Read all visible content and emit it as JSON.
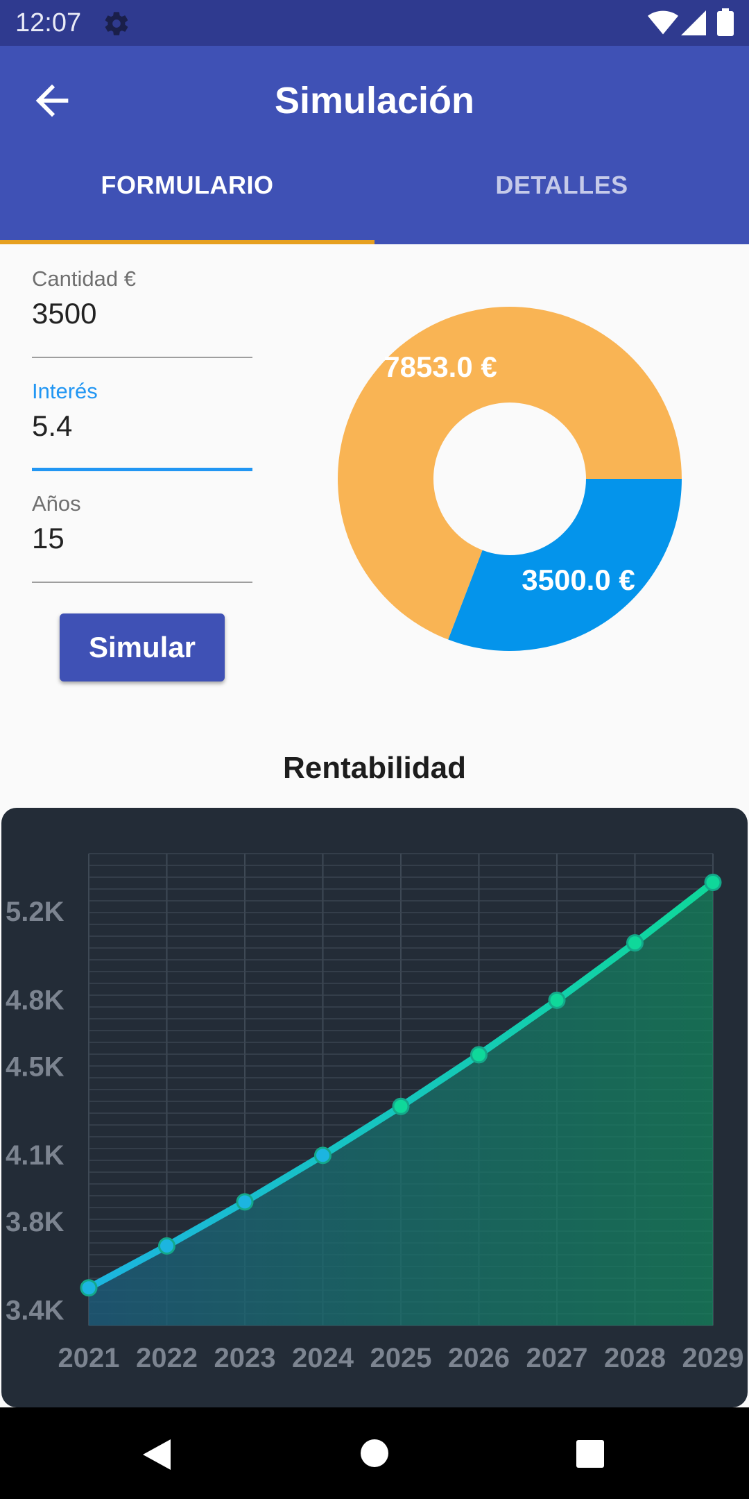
{
  "status_bar": {
    "time": "12:07"
  },
  "app_bar": {
    "title": "Simulación"
  },
  "tabs": [
    {
      "label": "FORMULARIO",
      "selected": true
    },
    {
      "label": "DETALLES",
      "selected": false
    }
  ],
  "form": {
    "cantidad": {
      "label": "Cantidad €",
      "value": "3500"
    },
    "interes": {
      "label": "Interés",
      "value": "5.4"
    },
    "anos": {
      "label": "Años",
      "value": "15"
    },
    "submit_label": "Simular"
  },
  "pie": {
    "slices": [
      {
        "label": "7853.0 €",
        "value": 7853.0,
        "color": "#f9b454"
      },
      {
        "label": "3500.0 €",
        "value": 3500.0,
        "color": "#0494eb"
      }
    ]
  },
  "section": {
    "title": "Rentabilidad"
  },
  "chart_data": {
    "type": "line",
    "x": [
      "2021",
      "2022",
      "2023",
      "2024",
      "2025",
      "2026",
      "2027",
      "2028",
      "2029"
    ],
    "series": [
      {
        "values": [
          3500,
          3689,
          3888,
          4098,
          4319,
          4552,
          4798,
          5057,
          5330
        ]
      }
    ],
    "y_tick_labels": [
      "3.4K",
      "3.8K",
      "4.1K",
      "4.5K",
      "4.8K",
      "5.2K"
    ],
    "y_tick_values": [
      3400,
      3800,
      4100,
      4500,
      4800,
      5200
    ],
    "ylim": [
      3330,
      5460
    ],
    "grid": true
  },
  "colors": {
    "primary": "#3f51b5",
    "status_bar": "#2f3a8f",
    "tab_indicator": "#e6a020",
    "focus": "#2196f3",
    "chart_bg": "#232c37",
    "line_start": "#1cb5e0",
    "line_end": "#0fd89a"
  },
  "icons": {
    "back": "arrow-back-icon",
    "settings": "gear-icon",
    "wifi": "wifi-icon",
    "signal": "signal-icon",
    "battery": "battery-icon",
    "nav_back": "triangle-back-icon",
    "nav_home": "circle-home-icon",
    "nav_recents": "square-recents-icon"
  }
}
